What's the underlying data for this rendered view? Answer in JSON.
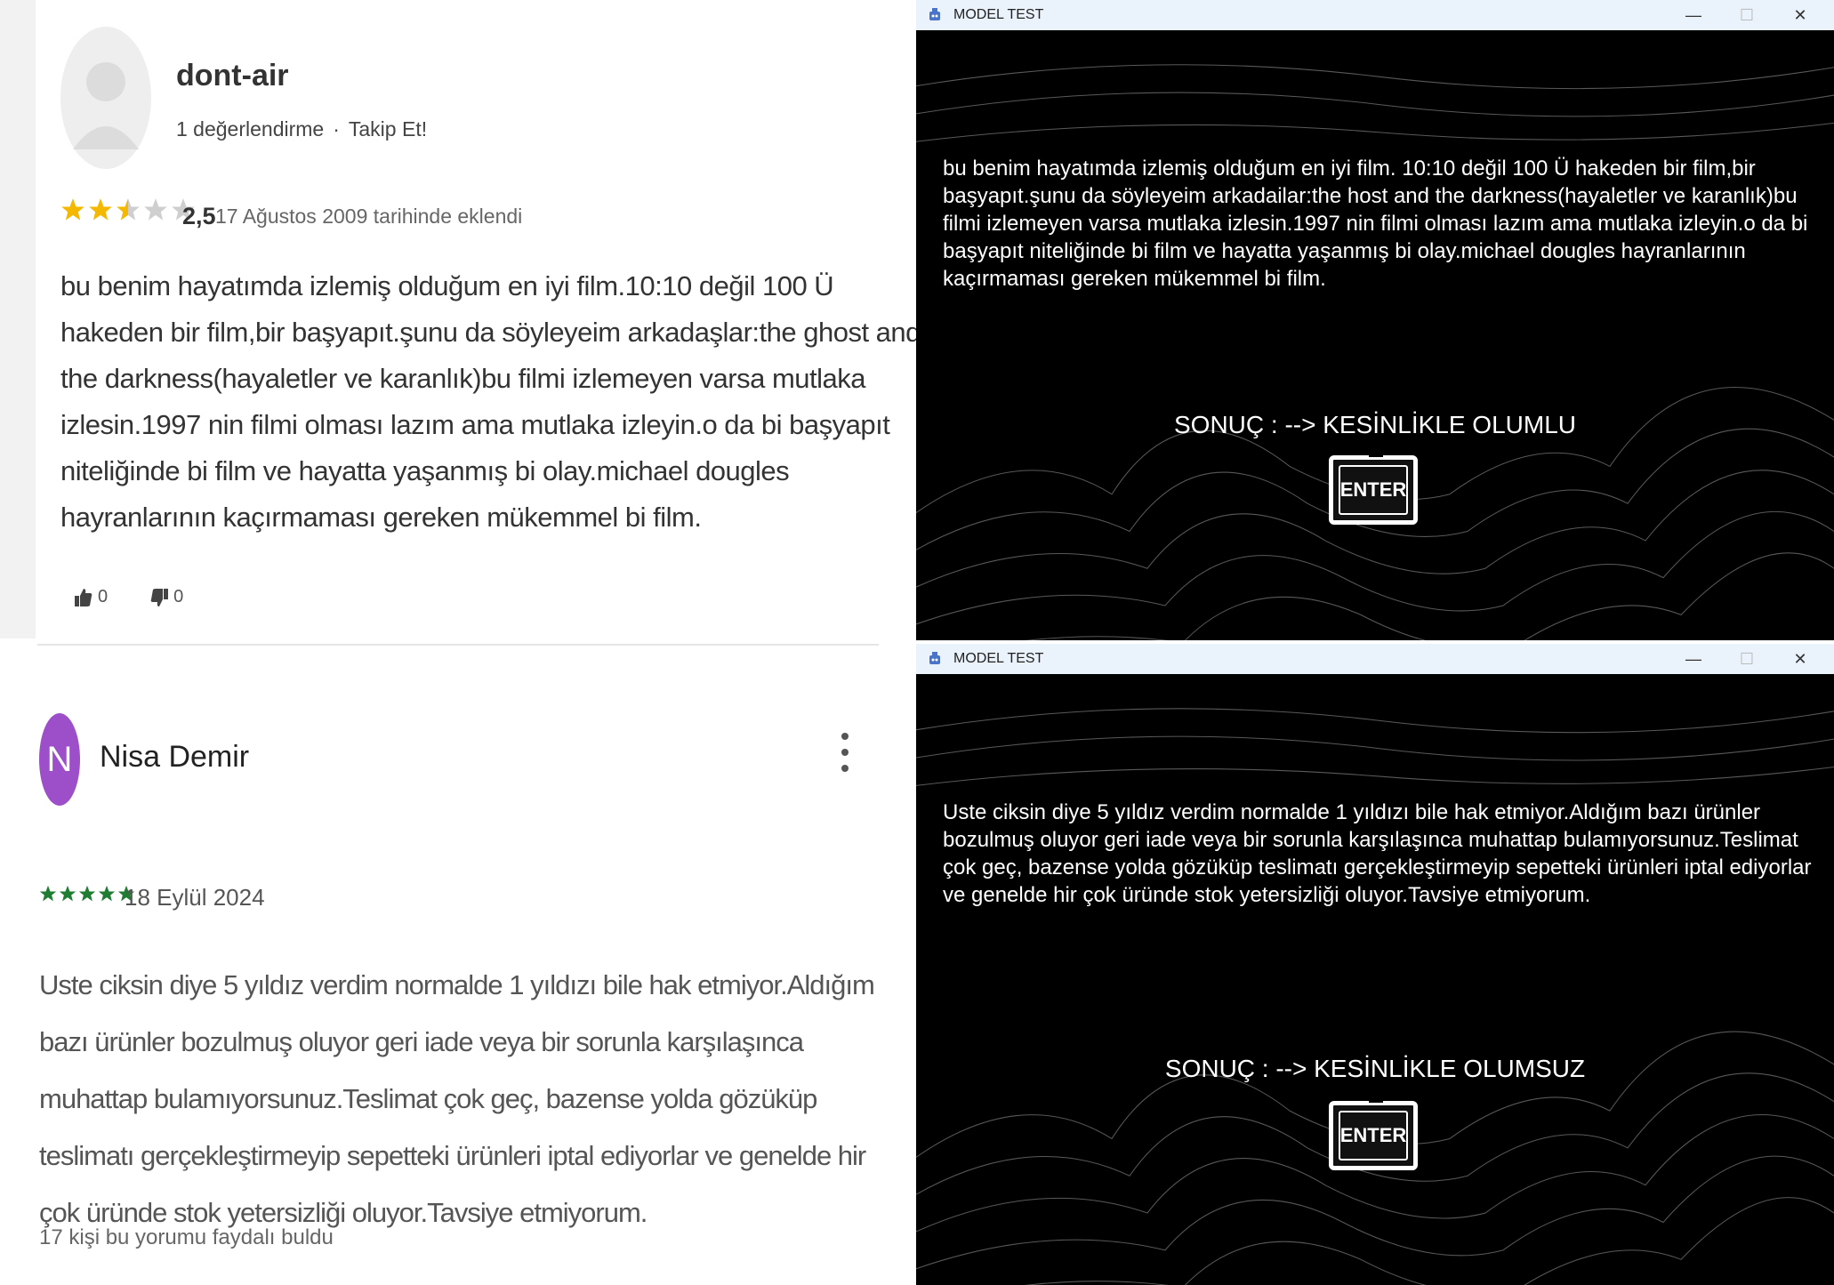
{
  "review1": {
    "username": "dont-air",
    "review_count": "1 değerlendirme",
    "follow": "Takip Et!",
    "rating": 2.5,
    "rating_text": "2,5",
    "date": "17 Ağustos 2009 tarihinde eklendi",
    "text": "bu benim hayatımda izlemiş olduğum en iyi film.10:10 değil 100 Ü hakeden bir film,bir başyapıt.şunu da söyleyeim arkadaşlar:the ghost and the darkness(hayaletler ve karanlık)bu filmi izlemeyen varsa mutlaka izlesin.1997 nin filmi olması lazım ama mutlaka izleyin.o da bi başyapıt niteliğinde bi film ve hayatta yaşanmış bi olay.michael dougles hayranlarının kaçırmaması gereken mükemmel bi film.",
    "likes": "0",
    "dislikes": "0"
  },
  "review2": {
    "avatar_letter": "N",
    "name": "Nisa Demir",
    "rating": 5,
    "date": "18 Eylül 2024",
    "text": "Uste ciksin diye 5 yıldız verdim normalde 1 yıldızı bile hak etmiyor.Aldığım bazı ürünler bozulmuş oluyor geri iade veya bir sorunla karşılaşınca muhattap bulamıyorsunuz.Teslimat çok geç, bazense yolda gözüküp teslimatı gerçekleştirmeyip sepetteki ürünleri iptal ediyorlar ve genelde hir çok üründe stok yetersizliği oluyor.Tavsiye etmiyorum.",
    "helpful": "17 kişi bu yorumu faydalı buldu"
  },
  "window1": {
    "title": "MODEL TEST",
    "input_text": "bu benim hayatımda izlemiş olduğum en iyi film. 10:10 değil 100 Ü hakeden bir film,bir başyapıt.şunu da söyleyeim arkadailar:the host and the darkness(hayaletler ve karanlık)bu filmi izlemeyen varsa mutlaka izlesin.1997 nin filmi olması lazım ama mutlaka izleyin.o da bi başyapıt niteliğinde bi film ve hayatta yaşanmış bi olay.michael dougles hayranlarının kaçırmaması gereken mükemmel bi film.",
    "result": "SONUÇ :  --> KESİNLİKLE OLUMLU",
    "enter_label": "ENTER"
  },
  "window2": {
    "title": "MODEL TEST",
    "input_text": "Uste ciksin diye 5 yıldız verdim normalde 1 yıldızı bile hak etmiyor.Aldığım bazı ürünler bozulmuş oluyor geri iade veya bir sorunla karşılaşınca muhattap bulamıyorsunuz.Teslimat çok geç, bazense yolda gözüküp teslimatı gerçekleştirmeyip sepetteki ürünleri iptal ediyorlar ve genelde hir çok üründe stok yetersizliği oluyor.Tavsiye etmiyorum.",
    "result": "SONUÇ :  --> KESİNLİKLE OLUMSUZ",
    "enter_label": "ENTER"
  },
  "colors": {
    "star_gold": "#f5b800",
    "star_empty": "#cfcfcf",
    "star_green": "#1e7d32",
    "avatar_purple": "#9c4fc9"
  }
}
